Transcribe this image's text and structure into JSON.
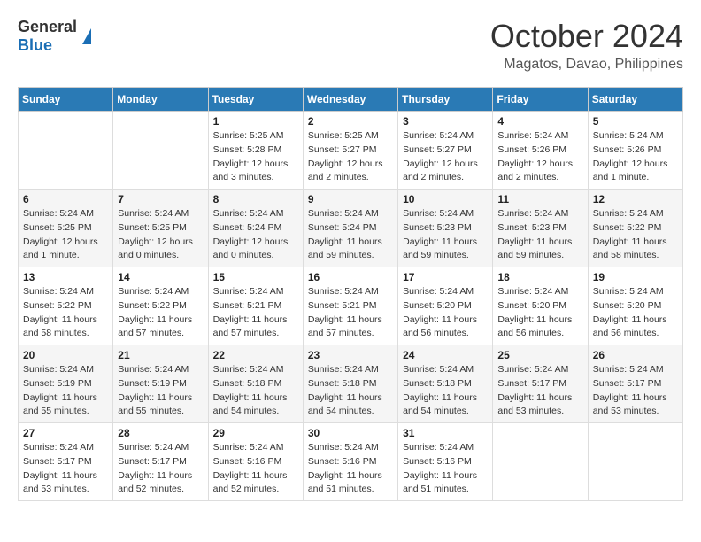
{
  "header": {
    "logo": {
      "general": "General",
      "blue": "Blue"
    },
    "month": "October 2024",
    "location": "Magatos, Davao, Philippines"
  },
  "weekdays": [
    "Sunday",
    "Monday",
    "Tuesday",
    "Wednesday",
    "Thursday",
    "Friday",
    "Saturday"
  ],
  "weeks": [
    [
      {
        "day": "",
        "info": ""
      },
      {
        "day": "",
        "info": ""
      },
      {
        "day": "1",
        "info": "Sunrise: 5:25 AM\nSunset: 5:28 PM\nDaylight: 12 hours\nand 3 minutes."
      },
      {
        "day": "2",
        "info": "Sunrise: 5:25 AM\nSunset: 5:27 PM\nDaylight: 12 hours\nand 2 minutes."
      },
      {
        "day": "3",
        "info": "Sunrise: 5:24 AM\nSunset: 5:27 PM\nDaylight: 12 hours\nand 2 minutes."
      },
      {
        "day": "4",
        "info": "Sunrise: 5:24 AM\nSunset: 5:26 PM\nDaylight: 12 hours\nand 2 minutes."
      },
      {
        "day": "5",
        "info": "Sunrise: 5:24 AM\nSunset: 5:26 PM\nDaylight: 12 hours\nand 1 minute."
      }
    ],
    [
      {
        "day": "6",
        "info": "Sunrise: 5:24 AM\nSunset: 5:25 PM\nDaylight: 12 hours\nand 1 minute."
      },
      {
        "day": "7",
        "info": "Sunrise: 5:24 AM\nSunset: 5:25 PM\nDaylight: 12 hours\nand 0 minutes."
      },
      {
        "day": "8",
        "info": "Sunrise: 5:24 AM\nSunset: 5:24 PM\nDaylight: 12 hours\nand 0 minutes."
      },
      {
        "day": "9",
        "info": "Sunrise: 5:24 AM\nSunset: 5:24 PM\nDaylight: 11 hours\nand 59 minutes."
      },
      {
        "day": "10",
        "info": "Sunrise: 5:24 AM\nSunset: 5:23 PM\nDaylight: 11 hours\nand 59 minutes."
      },
      {
        "day": "11",
        "info": "Sunrise: 5:24 AM\nSunset: 5:23 PM\nDaylight: 11 hours\nand 59 minutes."
      },
      {
        "day": "12",
        "info": "Sunrise: 5:24 AM\nSunset: 5:22 PM\nDaylight: 11 hours\nand 58 minutes."
      }
    ],
    [
      {
        "day": "13",
        "info": "Sunrise: 5:24 AM\nSunset: 5:22 PM\nDaylight: 11 hours\nand 58 minutes."
      },
      {
        "day": "14",
        "info": "Sunrise: 5:24 AM\nSunset: 5:22 PM\nDaylight: 11 hours\nand 57 minutes."
      },
      {
        "day": "15",
        "info": "Sunrise: 5:24 AM\nSunset: 5:21 PM\nDaylight: 11 hours\nand 57 minutes."
      },
      {
        "day": "16",
        "info": "Sunrise: 5:24 AM\nSunset: 5:21 PM\nDaylight: 11 hours\nand 57 minutes."
      },
      {
        "day": "17",
        "info": "Sunrise: 5:24 AM\nSunset: 5:20 PM\nDaylight: 11 hours\nand 56 minutes."
      },
      {
        "day": "18",
        "info": "Sunrise: 5:24 AM\nSunset: 5:20 PM\nDaylight: 11 hours\nand 56 minutes."
      },
      {
        "day": "19",
        "info": "Sunrise: 5:24 AM\nSunset: 5:20 PM\nDaylight: 11 hours\nand 56 minutes."
      }
    ],
    [
      {
        "day": "20",
        "info": "Sunrise: 5:24 AM\nSunset: 5:19 PM\nDaylight: 11 hours\nand 55 minutes."
      },
      {
        "day": "21",
        "info": "Sunrise: 5:24 AM\nSunset: 5:19 PM\nDaylight: 11 hours\nand 55 minutes."
      },
      {
        "day": "22",
        "info": "Sunrise: 5:24 AM\nSunset: 5:18 PM\nDaylight: 11 hours\nand 54 minutes."
      },
      {
        "day": "23",
        "info": "Sunrise: 5:24 AM\nSunset: 5:18 PM\nDaylight: 11 hours\nand 54 minutes."
      },
      {
        "day": "24",
        "info": "Sunrise: 5:24 AM\nSunset: 5:18 PM\nDaylight: 11 hours\nand 54 minutes."
      },
      {
        "day": "25",
        "info": "Sunrise: 5:24 AM\nSunset: 5:17 PM\nDaylight: 11 hours\nand 53 minutes."
      },
      {
        "day": "26",
        "info": "Sunrise: 5:24 AM\nSunset: 5:17 PM\nDaylight: 11 hours\nand 53 minutes."
      }
    ],
    [
      {
        "day": "27",
        "info": "Sunrise: 5:24 AM\nSunset: 5:17 PM\nDaylight: 11 hours\nand 53 minutes."
      },
      {
        "day": "28",
        "info": "Sunrise: 5:24 AM\nSunset: 5:17 PM\nDaylight: 11 hours\nand 52 minutes."
      },
      {
        "day": "29",
        "info": "Sunrise: 5:24 AM\nSunset: 5:16 PM\nDaylight: 11 hours\nand 52 minutes."
      },
      {
        "day": "30",
        "info": "Sunrise: 5:24 AM\nSunset: 5:16 PM\nDaylight: 11 hours\nand 51 minutes."
      },
      {
        "day": "31",
        "info": "Sunrise: 5:24 AM\nSunset: 5:16 PM\nDaylight: 11 hours\nand 51 minutes."
      },
      {
        "day": "",
        "info": ""
      },
      {
        "day": "",
        "info": ""
      }
    ]
  ]
}
